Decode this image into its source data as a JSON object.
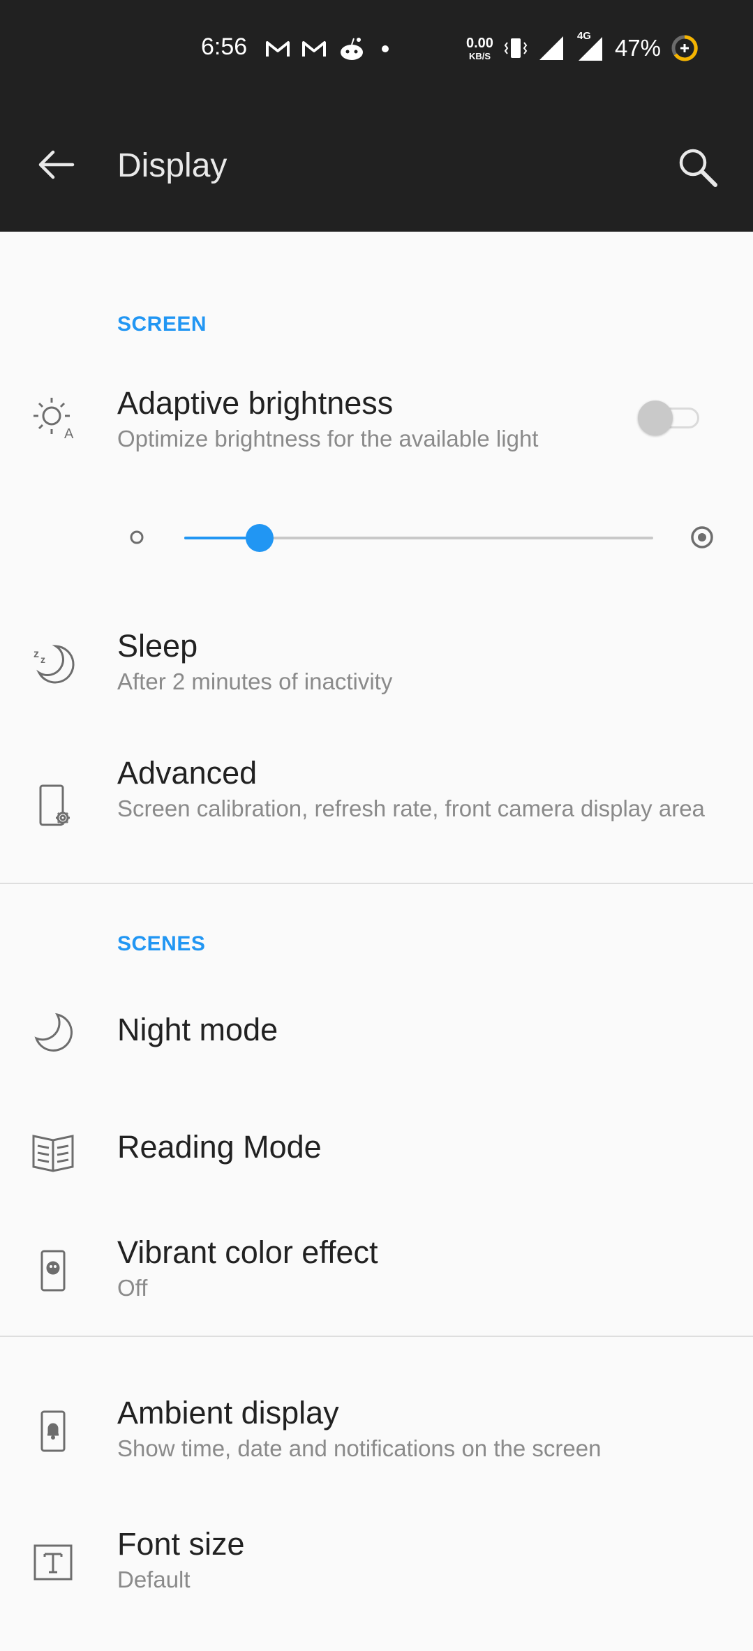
{
  "status_bar": {
    "time": "6:56",
    "net_speed_value": "0.00",
    "net_speed_unit": "KB/S",
    "network_label": "4G",
    "battery": "47%"
  },
  "app_bar": {
    "title": "Display"
  },
  "sections": {
    "screen": "SCREEN",
    "scenes": "SCENES"
  },
  "items": {
    "adaptive_brightness": {
      "title": "Adaptive brightness",
      "subtitle": "Optimize brightness for the available light",
      "enabled": false
    },
    "brightness_level": 0.16,
    "sleep": {
      "title": "Sleep",
      "subtitle": "After 2 minutes of inactivity"
    },
    "advanced": {
      "title": "Advanced",
      "subtitle": "Screen calibration, refresh rate, front camera display area"
    },
    "night_mode": {
      "title": "Night mode"
    },
    "reading_mode": {
      "title": "Reading Mode"
    },
    "vibrant_color": {
      "title": "Vibrant color effect",
      "subtitle": "Off"
    },
    "ambient_display": {
      "title": "Ambient display",
      "subtitle": "Show time, date and notifications on the screen"
    },
    "font_size": {
      "title": "Font size",
      "subtitle": "Default"
    }
  },
  "colors": {
    "accent": "#2196f3",
    "bar": "#212121",
    "background": "#fafafa"
  },
  "icons": [
    "back-arrow-icon",
    "search-icon",
    "brightness-auto-icon",
    "sleep-moon-icon",
    "phone-settings-icon",
    "moon-icon",
    "book-icon",
    "palette-phone-icon",
    "ambient-bell-icon",
    "font-size-icon"
  ]
}
